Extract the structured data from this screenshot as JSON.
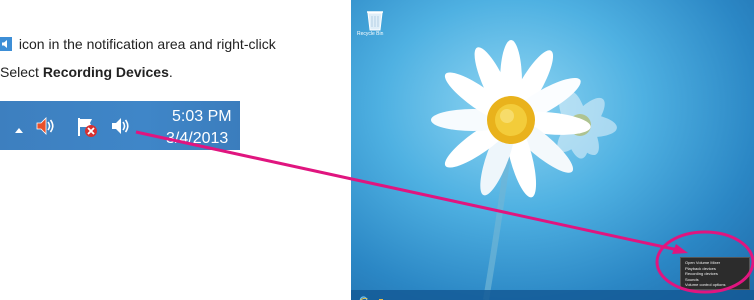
{
  "instructions": {
    "line1_text": "icon in the notification area and right-click",
    "line2_prefix": "Select ",
    "line2_bold": "Recording Devices",
    "line2_suffix": "."
  },
  "tray": {
    "time": "5:03 PM",
    "date": "3/4/2013",
    "icons": [
      "chevron-up-icon",
      "volume-red-icon",
      "action-center-flag-icon",
      "speaker-icon"
    ]
  },
  "desktop": {
    "recycle_bin_label": "Recycle Bin",
    "context_menu": {
      "items": [
        "Open Volume Mixer",
        "Playback devices",
        "Recording devices",
        "Sounds",
        "Volume control options"
      ]
    },
    "taskbar_icons": [
      "internet-explorer-icon",
      "file-explorer-icon"
    ]
  },
  "colors": {
    "arrow": "#e0157f",
    "taskbar": "#3f86c8",
    "wallpaper": "#4fb1e2",
    "highlight_circle": "#e0157f"
  }
}
